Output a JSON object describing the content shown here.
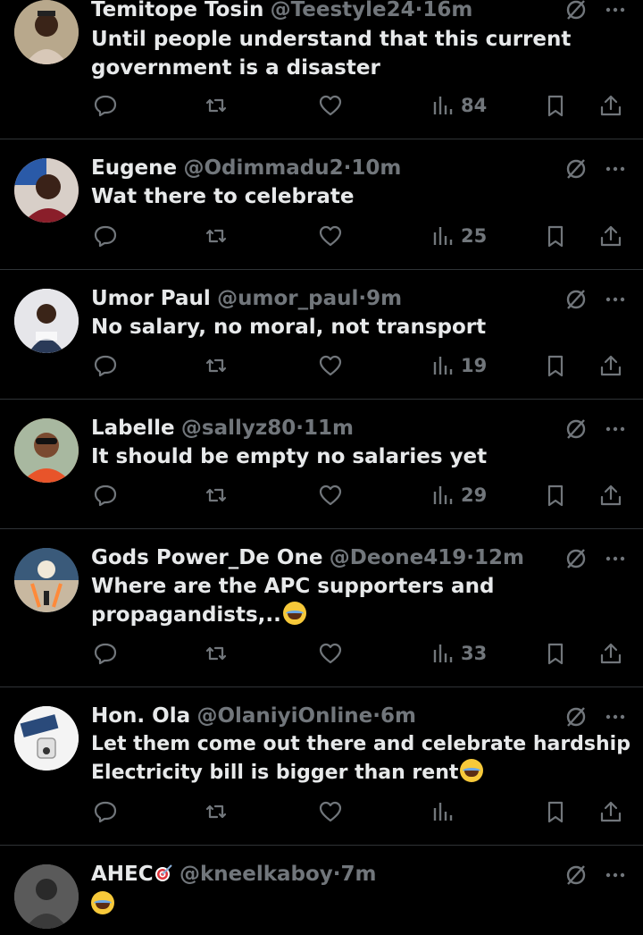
{
  "tweets": [
    {
      "name": "Temitope Tosin",
      "handle": "@Teestyle24",
      "time": "16m",
      "text": "Until people understand that this current government is a disaster",
      "views": "84",
      "avatar_color": "#8a7a6a"
    },
    {
      "name": "Eugene",
      "handle": "@Odimmadu2",
      "time": "10m",
      "text": "Wat there to celebrate",
      "views": "25",
      "avatar_color": "#8a3a3a"
    },
    {
      "name": "Umor Paul",
      "handle": "@umor_paul",
      "time": "9m",
      "text": "No salary, no moral, not transport",
      "views": "19",
      "avatar_color": "#e8e8ea"
    },
    {
      "name": "Labelle",
      "handle": "@sallyz80",
      "time": "11m",
      "text": "It should be empty no salaries yet",
      "views": "29",
      "avatar_color": "#c97a4a"
    },
    {
      "name": "Gods Power_De One",
      "handle": "@Deone419",
      "time": "12m",
      "text": "Where are the APC supporters and propagandists,..",
      "views": "33",
      "avatar_color": "#4a6a8a"
    },
    {
      "name": "Hon. Ola",
      "handle": "@OlaniyiOnline",
      "time": "6m",
      "text": "Let them come out there and celebrate hardship Electricity bill is bigger than rent",
      "views": "",
      "avatar_color": "#f2f2f2"
    },
    {
      "name": "AHEC",
      "handle": "@kneelkaboy",
      "time": "7m",
      "text": "",
      "views": "",
      "avatar_color": "#6a6a6a"
    }
  ],
  "separator": "·",
  "icons": {
    "reply": "reply-icon",
    "retweet": "retweet-icon",
    "like": "heart-icon",
    "views": "views-icon",
    "bookmark": "bookmark-icon",
    "share": "share-icon",
    "grok": "grok-icon",
    "more": "more-icon"
  },
  "colors": {
    "background": "#000000",
    "text": "#e7e9ea",
    "muted": "#71767b",
    "divider": "#2f3336"
  }
}
